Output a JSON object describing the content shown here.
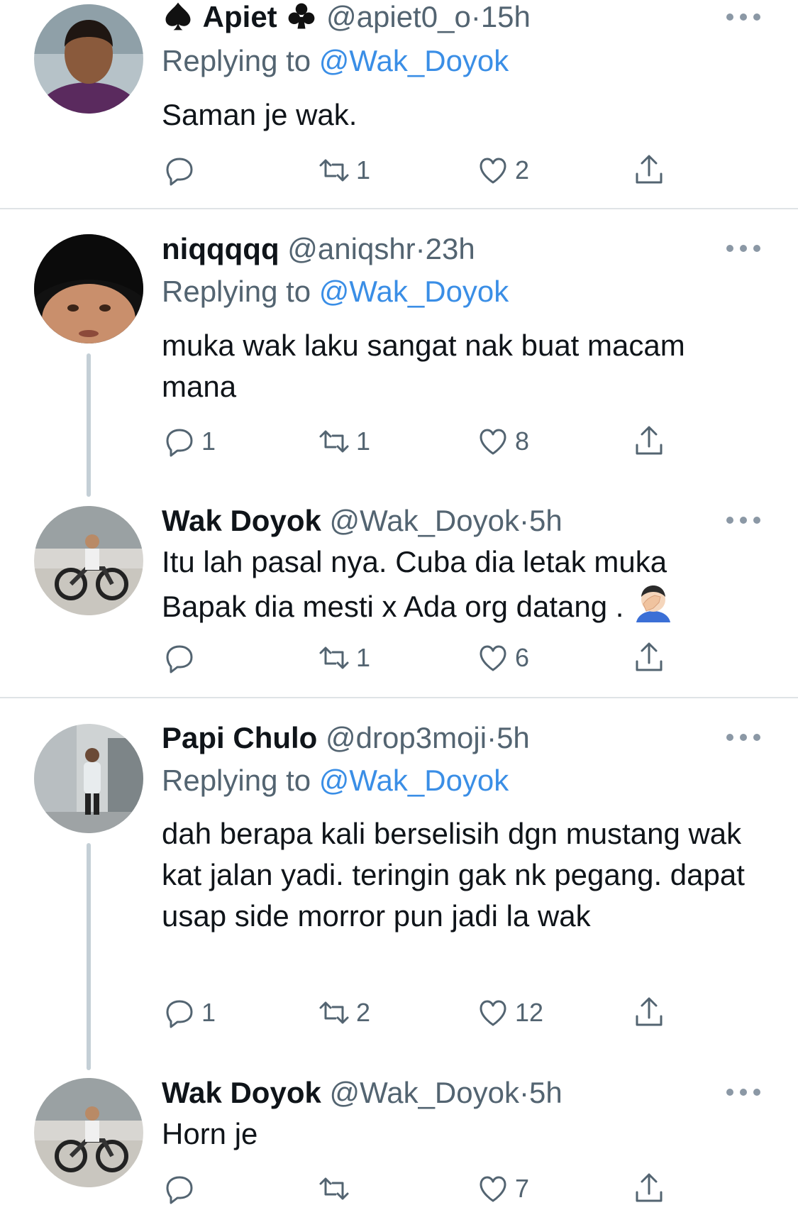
{
  "tweets": [
    {
      "name_prefix_icon": "spade-icon",
      "name": "Apiet",
      "name_suffix_icon": "club-icon",
      "handle": "@apiet0_o",
      "dot": "·",
      "time": "15h",
      "replying_label": "Replying to",
      "replying_to": "@Wak_Doyok",
      "text": "Saman je wak.",
      "replies": "",
      "retweets": "1",
      "likes": "2"
    },
    {
      "name": "niqqqqq",
      "handle": "@aniqshr",
      "dot": "·",
      "time": "23h",
      "replying_label": "Replying to",
      "replying_to": "@Wak_Doyok",
      "text": "muka wak laku sangat nak buat macam mana",
      "replies": "1",
      "retweets": "1",
      "likes": "8"
    },
    {
      "name": "Wak Doyok",
      "handle": "@Wak_Doyok",
      "dot": "·",
      "time": "5h",
      "text_line1": "Itu lah pasal nya. Cuba dia letak muka",
      "text_line2": "Bapak dia mesti x Ada org datang .",
      "emoji": "face-palm-emoji",
      "replies": "",
      "retweets": "1",
      "likes": "6"
    },
    {
      "name": "Papi Chulo",
      "handle": "@drop3moji",
      "dot": "·",
      "time": "5h",
      "replying_label": "Replying to",
      "replying_to": "@Wak_Doyok",
      "text": "dah berapa kali berselisih dgn mustang wak kat jalan yadi. teringin gak nk pegang. dapat usap side morror pun jadi la wak",
      "replies": "1",
      "retweets": "2",
      "likes": "12"
    },
    {
      "name": "Wak Doyok",
      "handle": "@Wak_Doyok",
      "dot": "·",
      "time": "5h",
      "text": "Horn je",
      "replies": "",
      "retweets": "",
      "likes": "7"
    }
  ],
  "colors": {
    "mention": "#3a8ee6",
    "secondary": "#536471",
    "thread_line": "#c4cfd6"
  }
}
